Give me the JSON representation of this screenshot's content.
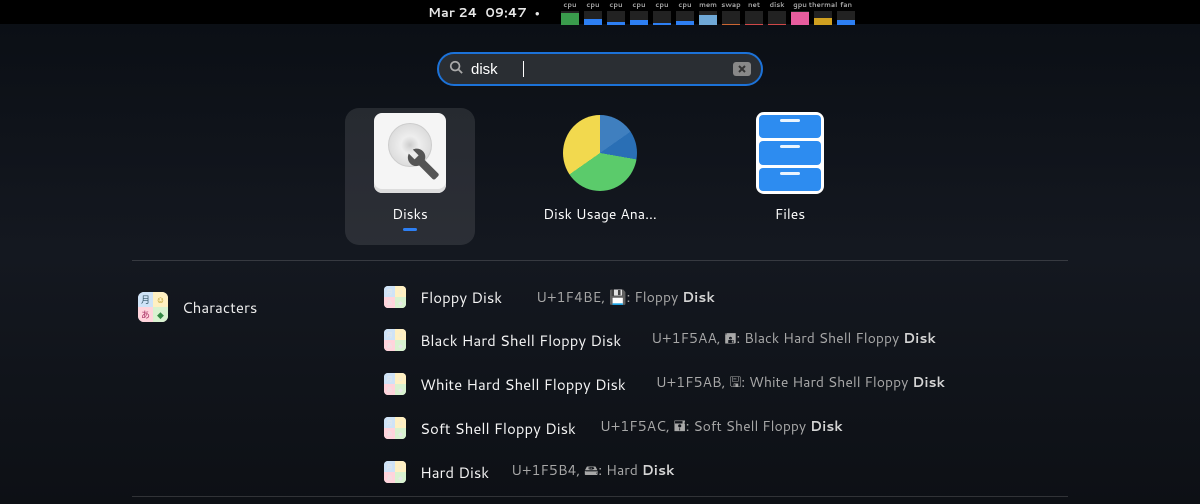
{
  "topbar": {
    "date": "Mar 24",
    "time": "09:47",
    "sys_items": [
      {
        "label": "cpu",
        "color": "#3a9b4c",
        "h": 12
      },
      {
        "label": "cpu",
        "color": "#2d7ff3",
        "h": 6
      },
      {
        "label": "cpu",
        "color": "#2d7ff3",
        "h": 3
      },
      {
        "label": "cpu",
        "color": "#2d7ff3",
        "h": 5
      },
      {
        "label": "cpu",
        "color": "#2d7ff3",
        "h": 2
      },
      {
        "label": "cpu",
        "color": "#2d7ff3",
        "h": 4
      },
      {
        "label": "mem",
        "color": "#6fa8d6",
        "h": 10
      },
      {
        "label": "swap",
        "color": "#cc6633",
        "h": 1
      },
      {
        "label": "net",
        "color": "#d04848",
        "h": 1
      },
      {
        "label": "disk",
        "color": "#d04848",
        "h": 1
      },
      {
        "label": "gpu",
        "color": "#e85c9e",
        "h": 13
      },
      {
        "label": "thermal",
        "color": "#d0a020",
        "h": 7
      },
      {
        "label": "fan",
        "color": "#2d7ff3",
        "h": 5
      }
    ]
  },
  "search": {
    "value": "disk",
    "placeholder": ""
  },
  "apps": [
    {
      "label": "Disks",
      "selected": true,
      "running": true,
      "kind": "disks"
    },
    {
      "label": "Disk Usage Ana…",
      "selected": false,
      "running": false,
      "kind": "pie"
    },
    {
      "label": "Files",
      "selected": false,
      "running": false,
      "kind": "files"
    }
  ],
  "characters": {
    "title": "Characters",
    "items": [
      {
        "name": "Floppy Disk",
        "code": "U+1F4BE",
        "glyph": "💾",
        "desc_pre": ": Floppy ",
        "desc_bold": "Disk"
      },
      {
        "name": "Black Hard Shell Floppy Disk",
        "code": "U+1F5AA",
        "glyph": "🖪",
        "desc_pre": ": Black Hard Shell Floppy ",
        "desc_bold": "Disk"
      },
      {
        "name": "White Hard Shell Floppy Disk",
        "code": "U+1F5AB",
        "glyph": "🖫",
        "desc_pre": ": White Hard Shell Floppy ",
        "desc_bold": "Disk"
      },
      {
        "name": "Soft Shell Floppy Disk",
        "code": "U+1F5AC",
        "glyph": "🖬",
        "desc_pre": ": Soft Shell Floppy ",
        "desc_bold": "Disk"
      },
      {
        "name": "Hard Disk",
        "code": "U+1F5B4",
        "glyph": "🖴",
        "desc_pre": ": Hard ",
        "desc_bold": "Disk"
      }
    ]
  }
}
